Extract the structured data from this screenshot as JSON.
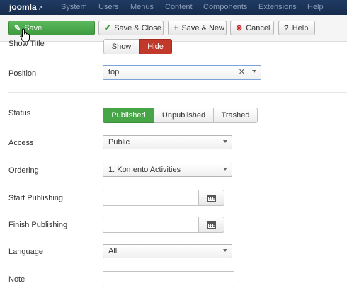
{
  "header": {
    "brand": "joomla",
    "menu": [
      "System",
      "Users",
      "Menus",
      "Content",
      "Components",
      "Extensions",
      "Help"
    ]
  },
  "toolbar": {
    "save": "Save",
    "save_close": "Save & Close",
    "save_new": "Save & New",
    "cancel": "Cancel",
    "help": "Help"
  },
  "form": {
    "show_title": {
      "label": "Show Title",
      "options": [
        "Show",
        "Hide"
      ],
      "selected": "Hide"
    },
    "position": {
      "label": "Position",
      "value": "top"
    },
    "status": {
      "label": "Status",
      "options": [
        "Published",
        "Unpublished",
        "Trashed"
      ],
      "selected": "Published"
    },
    "access": {
      "label": "Access",
      "value": "Public"
    },
    "ordering": {
      "label": "Ordering",
      "value": "1. Komento Activities"
    },
    "start_publishing": {
      "label": "Start Publishing",
      "value": ""
    },
    "finish_publishing": {
      "label": "Finish Publishing",
      "value": ""
    },
    "language": {
      "label": "Language",
      "value": "All"
    },
    "note": {
      "label": "Note",
      "value": ""
    }
  },
  "colors": {
    "save_green": "#46a546",
    "hide_red": "#c0392b",
    "topbar": "#1f3a63"
  }
}
